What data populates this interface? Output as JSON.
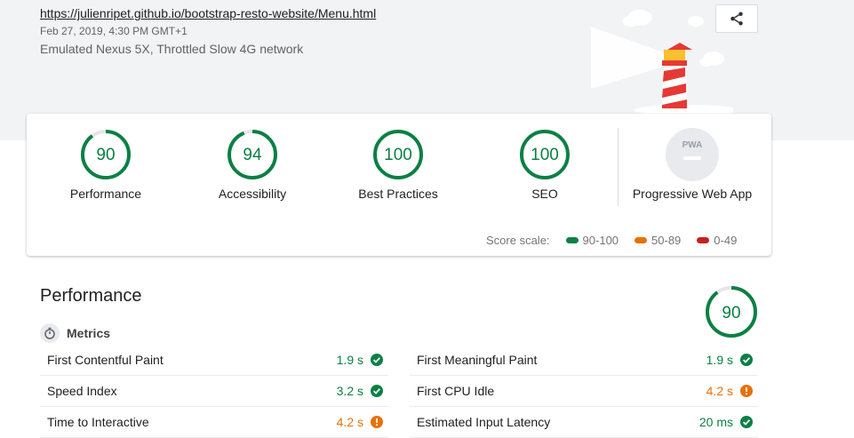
{
  "header": {
    "url": "https://julienripet.github.io/bootstrap-resto-website/Menu.html",
    "fetch_time": "Feb 27, 2019, 4:30 PM GMT+1",
    "environment": "Emulated Nexus 5X, Throttled Slow 4G network",
    "share_icon": "share-icon"
  },
  "categories": [
    {
      "label": "Performance",
      "score": "90",
      "fraction": 0.9
    },
    {
      "label": "Accessibility",
      "score": "94",
      "fraction": 0.94
    },
    {
      "label": "Best Practices",
      "score": "100",
      "fraction": 1.0
    },
    {
      "label": "SEO",
      "score": "100",
      "fraction": 1.0
    },
    {
      "label": "Progressive Web App",
      "score": "",
      "badge_text": "PWA"
    }
  ],
  "score_scale": {
    "label": "Score scale:",
    "ranges": [
      {
        "label": "90-100",
        "color": "#0b8043"
      },
      {
        "label": "50-89",
        "color": "#e8710a"
      },
      {
        "label": "0-49",
        "color": "#c5221f"
      }
    ]
  },
  "performance": {
    "title": "Performance",
    "score": "90",
    "fraction": 0.9,
    "metrics_title": "Metrics",
    "metrics": [
      {
        "name": "First Contentful Paint",
        "value": "1.9 s",
        "status": "pass"
      },
      {
        "name": "First Meaningful Paint",
        "value": "1.9 s",
        "status": "pass"
      },
      {
        "name": "Speed Index",
        "value": "3.2 s",
        "status": "pass"
      },
      {
        "name": "First CPU Idle",
        "value": "4.2 s",
        "status": "average"
      },
      {
        "name": "Time to Interactive",
        "value": "4.2 s",
        "status": "average"
      },
      {
        "name": "Estimated Input Latency",
        "value": "20 ms",
        "status": "pass"
      }
    ]
  },
  "colors": {
    "pass": "#0b8043",
    "average": "#e8710a",
    "fail": "#c5221f",
    "gauge_track": "#e6e6e6"
  }
}
